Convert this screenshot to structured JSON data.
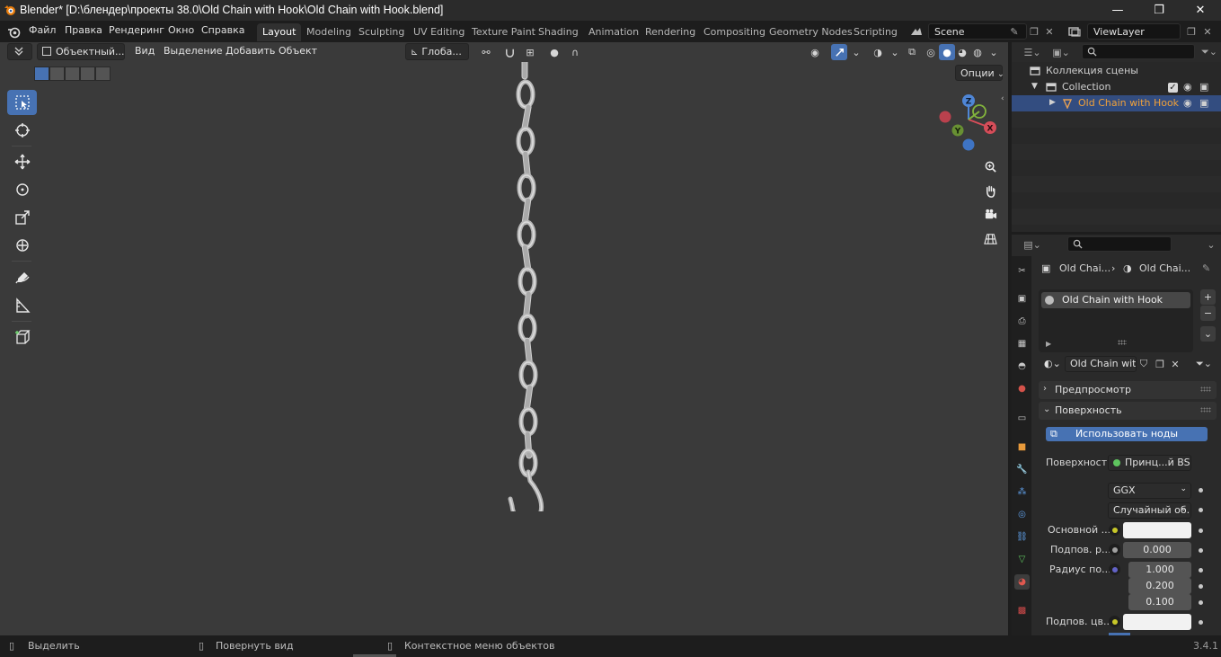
{
  "window": {
    "title": "Blender* [D:\\блендер\\проекты 38.0\\Old Chain with Hook\\Old Chain with Hook.blend]",
    "controls": {
      "minimize": "—",
      "maximize": "❐",
      "close": "✕"
    }
  },
  "topbar": {
    "menus": [
      "Файл",
      "Правка",
      "Рендеринг",
      "Окно",
      "Справка"
    ],
    "workspaces": [
      "Layout",
      "Modeling",
      "Sculpting",
      "UV Editing",
      "Texture Paint",
      "Shading",
      "Animation",
      "Rendering",
      "Compositing",
      "Geometry Nodes",
      "Scripting"
    ],
    "active_workspace": "Layout",
    "scene_name": "Scene",
    "view_layer": "ViewLayer"
  },
  "viewport": {
    "mode": "Объектный...",
    "menus": [
      "Вид",
      "Выделение",
      "Добавить",
      "Объект"
    ],
    "transform_orientation": "Глоба...",
    "options_label": "Опции",
    "gizmo_axes": {
      "x": "X",
      "y": "Y",
      "z": "Z"
    },
    "accent_color": "#4772b3",
    "background_color": "#3a3a3a"
  },
  "toolbar": {
    "tools": [
      "select-box",
      "cursor",
      "move",
      "rotate",
      "scale",
      "transform",
      "annotate",
      "measure",
      "add-cube"
    ],
    "active_tool": "select-box"
  },
  "outliner": {
    "search_placeholder": "",
    "root": "Коллекция сцены",
    "collection": "Collection",
    "object": "Old Chain with Hook"
  },
  "properties": {
    "breadcrumb_object": "Old Chai...",
    "breadcrumb_material": "Old Chai...",
    "material_slot": "Old Chain with Hook",
    "material_name": "Old Chain wit...",
    "panels": {
      "preview": "Предпросмотр",
      "surface": "Поверхность"
    },
    "use_nodes_button": "Использовать ноды",
    "surface_label": "Поверхность",
    "surface_shader": "Принц...й BSDF",
    "distribution": "GGX",
    "subsurface_method": "Случайный об...",
    "fields": [
      {
        "label": "Основной ...",
        "value": "",
        "socket_color": "#c7c729"
      },
      {
        "label": "Подпов. р...",
        "value": "0.000",
        "socket_color": "#a1a1a1"
      },
      {
        "label": "Радиус по...",
        "value": "1.000",
        "socket_color": "#6363c7"
      },
      {
        "label": "",
        "value": "0.200",
        "socket_color": ""
      },
      {
        "label": "",
        "value": "0.100",
        "socket_color": ""
      },
      {
        "label": "Подпов. цв...",
        "value": "",
        "socket_color": "#c7c729"
      }
    ]
  },
  "statusbar": {
    "items": [
      "Выделить",
      "Повернуть вид",
      "Контекстное меню объектов"
    ],
    "version": "3.4.1"
  }
}
